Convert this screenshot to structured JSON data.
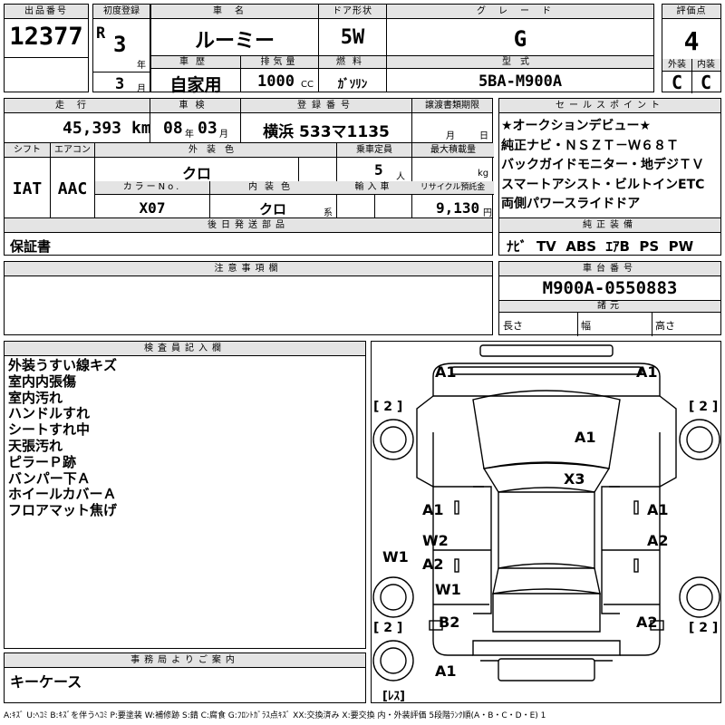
{
  "lot": {
    "label": "出品番号",
    "value": "12377"
  },
  "first_reg": {
    "label": "初度登録",
    "era": "R",
    "year_val": "3",
    "year_unit": "年",
    "month_val": "3",
    "month_unit": "月"
  },
  "car_name": {
    "label": "車名",
    "value": "ルーミー"
  },
  "door": {
    "label": "ドア形状",
    "value": "5W"
  },
  "grade": {
    "label": "グレード",
    "value": "G"
  },
  "score": {
    "label": "評価点",
    "value": "4",
    "ext_label": "外装",
    "int_label": "内装",
    "ext_value": "C",
    "int_value": "C"
  },
  "inspection": {
    "label": "車歴",
    "value": "自家用"
  },
  "displacement": {
    "label": "排気量",
    "value": "1000",
    "unit": "CC"
  },
  "fuel": {
    "label": "燃料",
    "value": "ｶﾞｿﾘﾝ"
  },
  "model": {
    "label": "型式",
    "value": "5BA-M900A"
  },
  "mileage": {
    "label": "走行",
    "value": "45,393",
    "unit": "km"
  },
  "shaken": {
    "label": "車検",
    "year": "08",
    "year_unit": "年",
    "month": "03",
    "month_unit": "月"
  },
  "plate": {
    "label": "登録番号",
    "value": "横浜 533マ1135"
  },
  "transfer": {
    "label": "譲渡書類期限",
    "month_unit": "月",
    "day_unit": "日"
  },
  "shift": {
    "label": "シフト",
    "value": "IAT"
  },
  "ac": {
    "label": "エアコン",
    "value": "AAC"
  },
  "ext_color": {
    "label": "外装色",
    "value": "クロ"
  },
  "capacity": {
    "label": "乗車定員",
    "value": "5",
    "unit": "人"
  },
  "max_load": {
    "label": "最大積載量",
    "unit": "kg"
  },
  "color_no": {
    "label": "カラーNo.",
    "value": "X07"
  },
  "int_color": {
    "label": "内装色",
    "value": "クロ",
    "unit": "系"
  },
  "import": {
    "label": "輸入車"
  },
  "recycle": {
    "label": "リサイクル預託金",
    "value": "9,130",
    "unit": "円"
  },
  "later": {
    "label": "後日発送部品",
    "value": "保証書"
  },
  "sales_points": {
    "label": "セールスポイント",
    "items": [
      "★オークションデビュー★",
      "純正ナビ・ＮＳＺＴ－Ｗ６８Ｔ",
      "バックガイドモニター・地デジＴＶ",
      "スマートアシスト・ビルトインETC",
      "両側パワースライドドア"
    ]
  },
  "equipment": {
    "label": "純正装備",
    "value": "ﾅﾋﾞ  TV  ABS  ｴｱB  PS  PW"
  },
  "notes": {
    "label": "注意事項欄"
  },
  "chassis": {
    "label": "車台番号",
    "value": "M900A-0550883"
  },
  "dims": {
    "label": "諸元",
    "length": "長さ",
    "width": "幅",
    "height": "高さ"
  },
  "inspector": {
    "label": "検査員記入欄",
    "items": [
      "外装うすい線キズ",
      "室内内張傷",
      "室内汚れ",
      "ハンドルすれ",
      "シートすれ中",
      "天張汚れ",
      "ピラーＰ跡",
      "バンパー下Ａ",
      "ホイールカバーＡ",
      "フロアマット焦げ"
    ]
  },
  "office": {
    "label": "事務局よりご案内",
    "value": "キーケース"
  },
  "diagram": {
    "marks": {
      "front_left": "A1",
      "front_right": "A1",
      "hood": "A1",
      "roof": "X3",
      "left_front_door": "A1",
      "right_front_door": "A1",
      "left_rear_door_w": "W2",
      "left_rear_door_a": "A2",
      "right_rear_door": "A2",
      "left_sill": "W1",
      "left_rear_q": "W1",
      "rear_bumper_left": "B2",
      "rear_right": "A2",
      "rear_bumper": "A1"
    },
    "tire_marks": {
      "fl": "[ 2 ]",
      "fr": "[ 2 ]",
      "rl": "[ 2 ]",
      "rr": "[ 2 ]",
      "spare": "[ﾚｽ]"
    }
  },
  "legend": "A:ｷｽﾞ  U:ﾍｺﾐ  B:ｷｽﾞを伴うﾍｺﾐ  P:要塗装  W:補修跡  S:錆  C:腐食  G:ﾌﾛﾝﾄｶﾞﾗｽ点ｷｽﾞ  XX:交換済み  X:要交換  内・外装評価  5段階ﾗﾝｸ順(A・B・C・D・E) 1"
}
